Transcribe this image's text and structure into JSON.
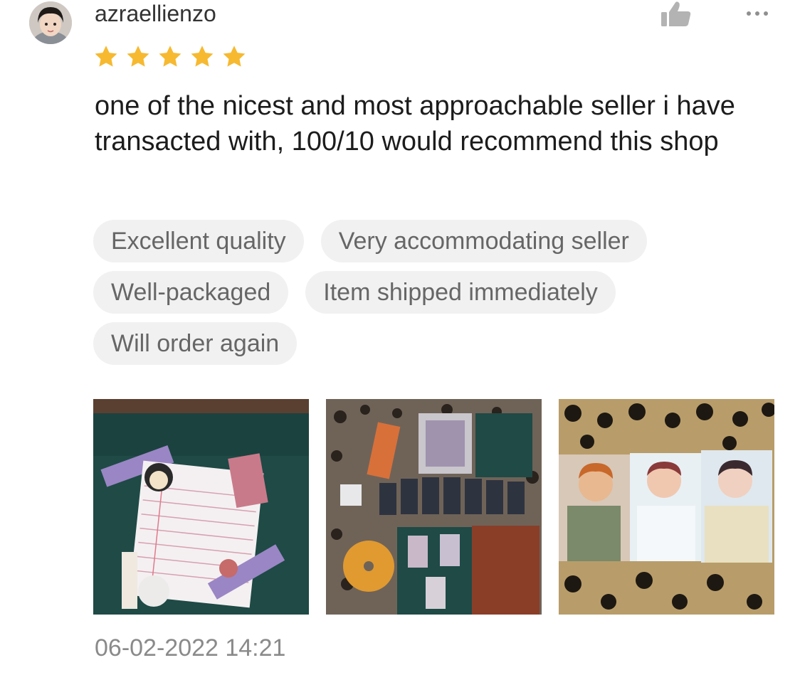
{
  "review": {
    "username": "azraellienzo",
    "rating": 5,
    "text": "one of the nicest and most approachable seller i have transacted with, 100/10 would recommend this shop",
    "tags": [
      "Excellent quality",
      "Very accommodating seller",
      "Well-packaged",
      "Item shipped immediately",
      "Will order again"
    ],
    "timestamp": "06-02-2022 14:21",
    "icons": {
      "like": "thumbs-up-icon",
      "more": "more-dots-icon",
      "star": "star-icon"
    },
    "colors": {
      "star": "#f6b930",
      "icon": "#b3b3b3",
      "tag_bg": "#f1f1f1"
    }
  }
}
